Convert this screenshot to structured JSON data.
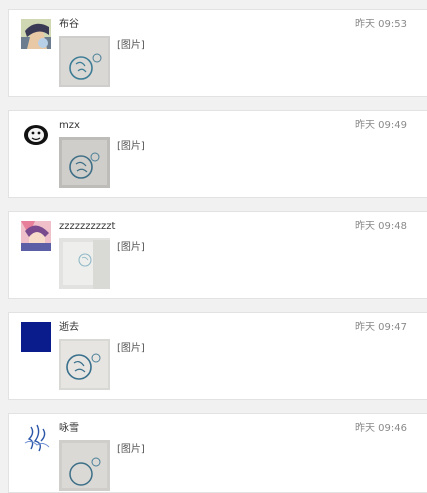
{
  "messages": [
    {
      "sender": "布谷",
      "time": "昨天 09:53",
      "content": "[图片]",
      "avatar_icon": "anime-avatar-icon"
    },
    {
      "sender": "mzx",
      "time": "昨天 09:49",
      "content": "[图片]",
      "avatar_icon": "meme-face-avatar-icon"
    },
    {
      "sender": "zzzzzzzzzzt",
      "time": "昨天 09:48",
      "content": "[图片]",
      "avatar_icon": "anime-girl-avatar-icon"
    },
    {
      "sender": "逝去",
      "time": "昨天 09:47",
      "content": "[图片]",
      "avatar_icon": "blue-square-avatar-icon"
    },
    {
      "sender": "咏雪",
      "time": "昨天 09:46",
      "content": "[图片]",
      "avatar_icon": "blue-sketch-avatar-icon"
    }
  ],
  "colors": {
    "page_background": "#f1f1f1",
    "card_background": "#ffffff",
    "time_text": "#8a8a8a",
    "blue_avatar": "#0a1c8c"
  }
}
